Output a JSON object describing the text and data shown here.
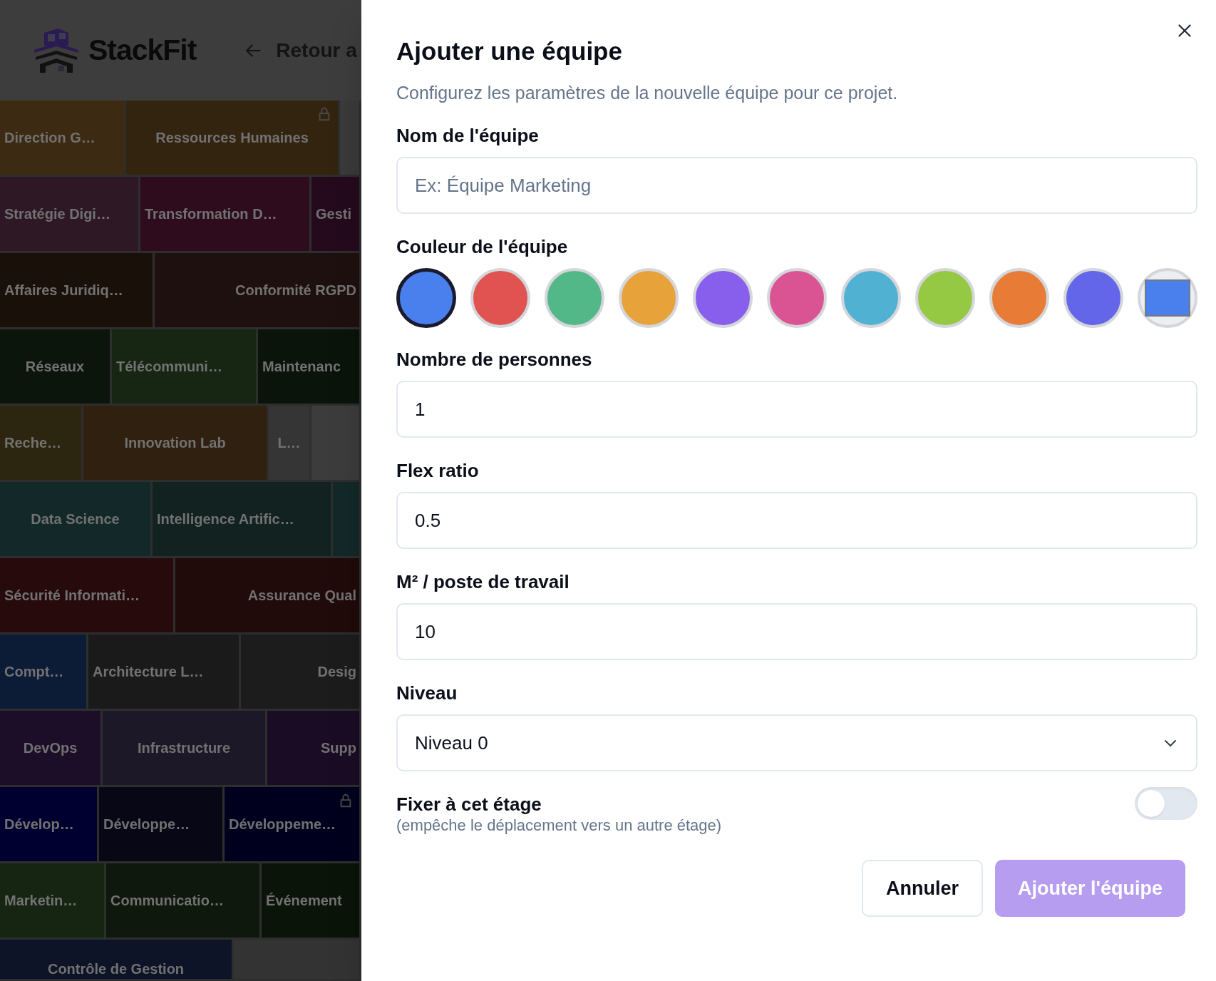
{
  "header": {
    "logo_text": "StackFit",
    "back_link": "Retour a"
  },
  "board": [
    [
      {
        "label": "Direction G…",
        "color": "#3d2a12",
        "locked": false
      },
      {
        "label": "Ressources Humaines",
        "color": "#33240f",
        "locked": true
      },
      {
        "color": "#3a3a3a",
        "locked": false
      }
    ],
    [
      {
        "label": "Stratégie Digi…",
        "color": "#2e1826",
        "locked": false
      },
      {
        "label": "Transformation D…",
        "color": "#2e0c1e",
        "locked": false
      },
      {
        "label": "Gesti",
        "color": "#250a1e",
        "locked": false
      }
    ],
    [
      {
        "label": "Affaires Juridiq…",
        "color": "#1a100a",
        "locked": false
      },
      {
        "label": "Conformité RGPD",
        "color": "#1e100e",
        "locked": false
      }
    ],
    [
      {
        "label": "Réseaux",
        "color": "#0c150c",
        "locked": false
      },
      {
        "label": "Télécommuni…",
        "color": "#162612",
        "locked": false
      },
      {
        "label": "Maintenanc",
        "color": "#0a140a",
        "locked": false
      }
    ],
    [
      {
        "label": "Reche…",
        "color": "#2c2610",
        "locked": false
      },
      {
        "label": "Innovation Lab",
        "color": "#30200f",
        "locked": false
      },
      {
        "label": "L…",
        "color": "#353535",
        "locked": false
      },
      {
        "color": "#3c3c3c",
        "locked": false
      }
    ],
    [
      {
        "label": "Data Science",
        "color": "#132828",
        "locked": false
      },
      {
        "label": "Intelligence Artific…",
        "color": "#112220",
        "locked": false
      },
      {
        "color": "#132828",
        "locked": false
      }
    ],
    [
      {
        "label": "Sécurité Informati…",
        "color": "#260a0c",
        "locked": false
      },
      {
        "label": "Assurance Qual",
        "color": "#200a0a",
        "locked": false
      }
    ],
    [
      {
        "label": "Compt…",
        "color": "#0c1c36",
        "locked": false
      },
      {
        "label": "Architecture L…",
        "color": "#1a1a1a",
        "locked": false
      },
      {
        "label": "Desig",
        "color": "#1c1c1c",
        "locked": false
      }
    ],
    [
      {
        "label": "DevOps",
        "color": "#1c0e28",
        "locked": false
      },
      {
        "label": "Infrastructure",
        "color": "#1c1828",
        "locked": false
      },
      {
        "label": "Supp",
        "color": "#1a0c24",
        "locked": false
      }
    ],
    [
      {
        "label": "Dévelop…",
        "color": "#000030",
        "locked": false
      },
      {
        "label": "Développe…",
        "color": "#070716",
        "locked": false
      },
      {
        "label": "Développeme…",
        "color": "#00001e",
        "locked": true
      }
    ],
    [
      {
        "label": "Marketin…",
        "color": "#162412",
        "locked": false
      },
      {
        "label": "Communicatio…",
        "color": "#0e180c",
        "locked": false
      },
      {
        "label": "Événement",
        "color": "#0a1408",
        "locked": false
      }
    ],
    [
      {
        "label": "Contrôle de Gestion",
        "color": "#0e1428",
        "locked": false
      },
      {
        "color": "#333333",
        "locked": false
      }
    ]
  ],
  "dialog": {
    "title": "Ajouter une équipe",
    "description": "Configurez les paramètres de la nouvelle équipe pour ce projet.",
    "name_field": {
      "label": "Nom de l'équipe",
      "placeholder": "Ex: Équipe Marketing"
    },
    "color_label": "Couleur de l'équipe",
    "colors": [
      {
        "kind": "swatch",
        "color": "#4a80ee",
        "selected": true
      },
      {
        "kind": "swatch",
        "color": "#e05350",
        "selected": false
      },
      {
        "kind": "swatch",
        "color": "#53b887",
        "selected": false
      },
      {
        "kind": "swatch",
        "color": "#e8a23a",
        "selected": false
      },
      {
        "kind": "swatch",
        "color": "#875fec",
        "selected": false
      },
      {
        "kind": "swatch",
        "color": "#da5494",
        "selected": false
      },
      {
        "kind": "swatch",
        "color": "#50b1d2",
        "selected": false
      },
      {
        "kind": "swatch",
        "color": "#95c943",
        "selected": false
      },
      {
        "kind": "swatch",
        "color": "#e87b35",
        "selected": false
      },
      {
        "kind": "swatch",
        "color": "#6366e8",
        "selected": false
      },
      {
        "kind": "custom",
        "color": "#4a80ee",
        "selected": false
      }
    ],
    "fields": [
      {
        "label": "Nombre de personnes",
        "value": "1"
      },
      {
        "label": "Flex ratio",
        "value": "0.5"
      },
      {
        "label": "M² / poste de travail",
        "value": "10"
      }
    ],
    "level_select": {
      "label": "Niveau",
      "value": "Niveau 0"
    },
    "pin_toggle": {
      "label": "Fixer à cet étage",
      "hint": "(empêche le déplacement vers un autre étage)",
      "on": false
    },
    "cancel_button": "Annuler",
    "submit_button": {
      "label": "Ajouter l'équipe",
      "disabled": true
    }
  }
}
